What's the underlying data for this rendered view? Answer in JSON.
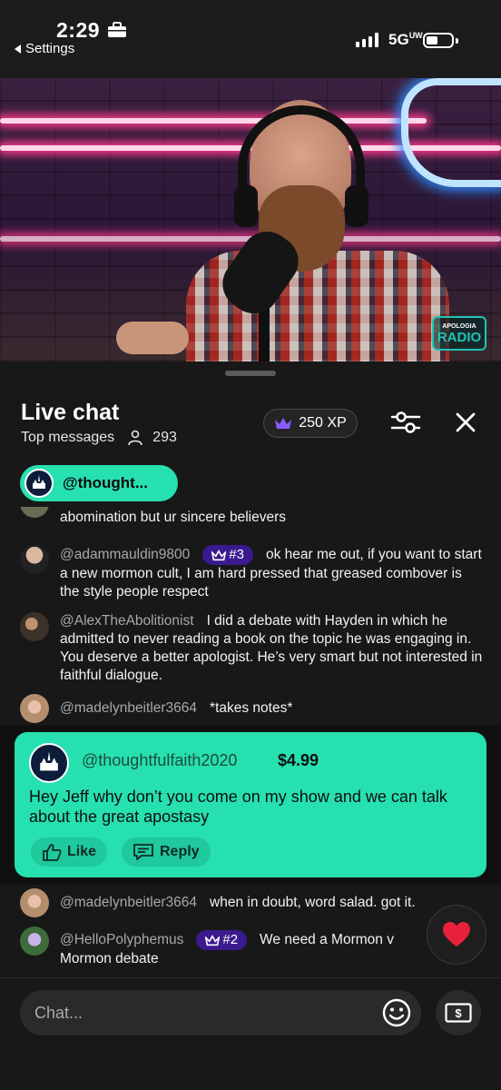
{
  "status_bar": {
    "time": "2:29",
    "back_label": "Settings",
    "network": "5G"
  },
  "video": {
    "logo_text": "RADIO",
    "logo_small": "APOLOGIA"
  },
  "chat": {
    "title": "Live chat",
    "filter_label": "Top messages",
    "viewer_count": "293",
    "xp_label": "250 XP",
    "pinned_chip_label": "@thought..."
  },
  "messages": [
    {
      "author": "",
      "rank": "",
      "text": "abomination but ur sincere believers"
    },
    {
      "author": "@adammauldin9800",
      "rank": "#3",
      "text": "ok hear me out, if you want to start a new mormon cult, I am hard pressed that greased combover is the style people respect"
    },
    {
      "author": "@AlexTheAbolitionist",
      "rank": "",
      "text": "I did a debate with Hayden in which he admitted to never reading a book on the topic he was engaging in. You deserve a better apologist. He’s very smart but not interested in faithful dialogue."
    },
    {
      "author": "@madelynbeitler3664",
      "rank": "",
      "text": "*takes notes*"
    },
    {
      "author": "@madelynbeitler3664",
      "rank": "",
      "text": "when in doubt, word salad. got it."
    },
    {
      "author": "@HelloPolyphemus",
      "rank": "#2",
      "text": "We need a Mormon v Mormon debate"
    }
  ],
  "super_chat": {
    "author": "@thoughtfulfaith2020",
    "amount": "$4.99",
    "text": "Hey Jeff why don’t you come on my show and we can talk about the great apostasy",
    "like_label": "Like",
    "reply_label": "Reply"
  },
  "input": {
    "placeholder": "Chat..."
  },
  "colors": {
    "accent": "#27e0b0",
    "rank_badge": "#3a1a8e",
    "panel": "#181818"
  }
}
